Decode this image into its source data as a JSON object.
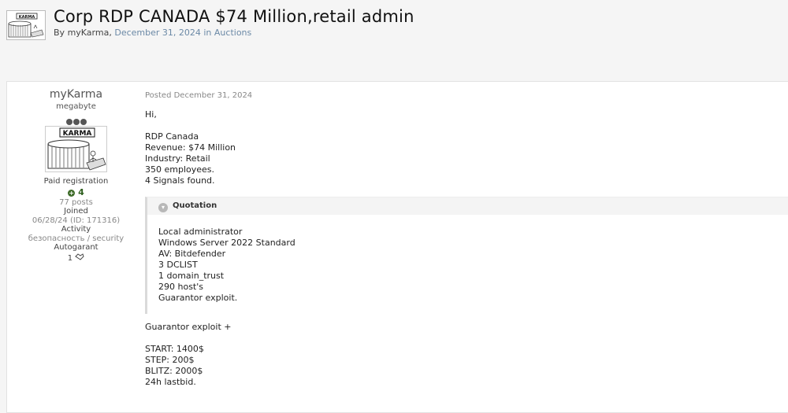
{
  "header": {
    "title": "Corp RDP CANADA $74 Million,retail admin",
    "by_prefix": "By",
    "author": "myKarma",
    "date": "December 31, 2024",
    "in_word": "in",
    "forum": "Auctions",
    "thumbnail_label": "KARMA"
  },
  "author_panel": {
    "name": "myKarma",
    "rank": "megabyte",
    "avatar_label": "KARMA",
    "group": "Paid registration",
    "reputation": "4",
    "posts": "77 posts",
    "joined_label": "Joined",
    "joined_value": "06/28/24 (ID: 171316)",
    "activity_label": "Activity",
    "activity_value": "безопасность / security",
    "autogarant_label": "Autogarant",
    "autogarant_value": "1"
  },
  "post": {
    "posted": "Posted December 31, 2024",
    "greeting": "Hi,",
    "lines": [
      "RDP Canada",
      "Revenue: $74 Million",
      "Industry: Retail",
      "350 employees.",
      "4 Signals found."
    ],
    "quote": {
      "title": "Quotation",
      "lines": [
        "Local administrator",
        "Windows Server 2022 Standard",
        "AV: Bitdefender",
        "3 DCLIST",
        "1 domain_trust",
        "290 host's",
        "Guarantor exploit."
      ]
    },
    "after_lines": [
      "Guarantor exploit +",
      "",
      "START: 1400$",
      "STEP: 200$",
      "BLITZ: 2000$",
      "24h lastbid."
    ]
  }
}
